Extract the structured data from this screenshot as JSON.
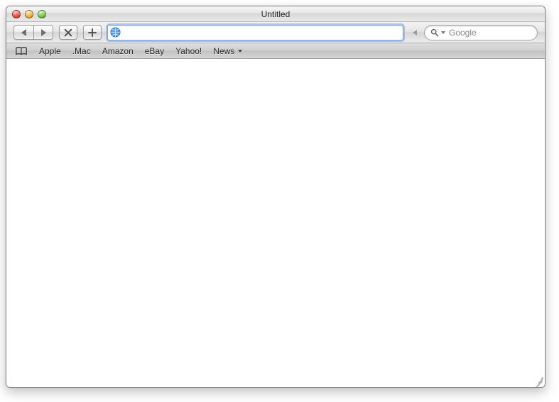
{
  "window": {
    "title": "Untitled"
  },
  "toolbar": {
    "url_value": "",
    "search_placeholder": "Google"
  },
  "bookmarks": {
    "items": [
      {
        "label": "Apple"
      },
      {
        "label": ".Mac"
      },
      {
        "label": "Amazon"
      },
      {
        "label": "eBay"
      },
      {
        "label": "Yahoo!"
      },
      {
        "label": "News"
      }
    ]
  }
}
